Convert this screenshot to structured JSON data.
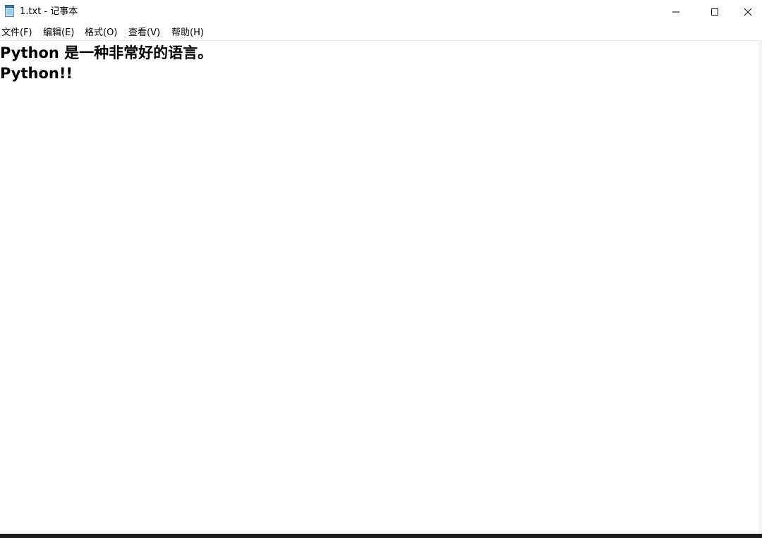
{
  "window": {
    "title": "1.txt - 记事本",
    "icon": "notepad-icon",
    "controls": {
      "minimize_icon": "minimize-icon",
      "maximize_icon": "maximize-icon",
      "close_icon": "close-icon"
    }
  },
  "menubar": {
    "file": "文件(F)",
    "edit": "编辑(E)",
    "format": "格式(O)",
    "view": "查看(V)",
    "help": "帮助(H)"
  },
  "editor": {
    "lines": [
      "Python 是一种非常好的语言。",
      "Python!!"
    ]
  },
  "colors": {
    "background": "#ffffff",
    "text": "#000000",
    "taskbar": "#1c1c1c"
  }
}
